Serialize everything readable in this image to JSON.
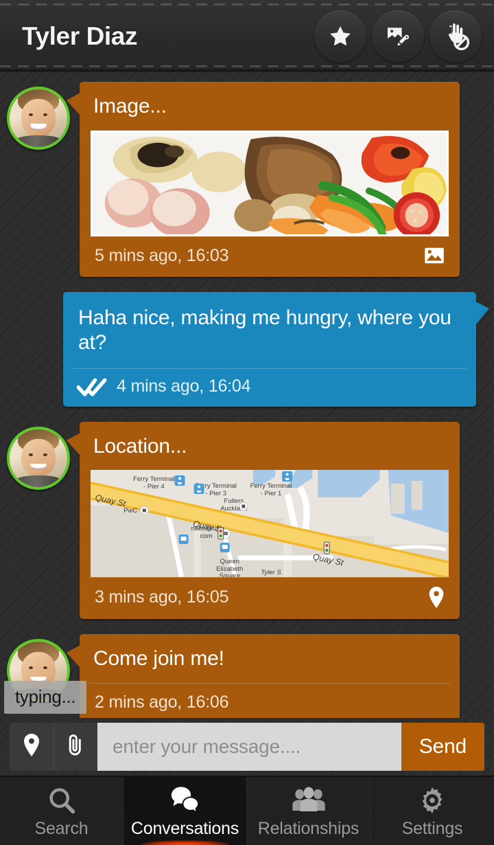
{
  "header": {
    "title": "Tyler Diaz",
    "actions": [
      {
        "name": "favorite-button",
        "icon": "star-icon"
      },
      {
        "name": "edit-photo-button",
        "icon": "image-pencil-icon"
      },
      {
        "name": "block-user-button",
        "icon": "hand-block-icon"
      }
    ]
  },
  "conversation": {
    "messages": [
      {
        "id": "m1",
        "side": "them",
        "sender": "Tyler Diaz",
        "type": "image",
        "text": "Image...",
        "time": "5 mins ago, 16:03",
        "icon": "picture-icon",
        "online": true
      },
      {
        "id": "m2",
        "side": "me",
        "type": "text",
        "text": "Haha nice, making me hungry, where you at?",
        "time": "4 mins ago, 16:04",
        "status_icon": "double-check-icon",
        "status": "read"
      },
      {
        "id": "m3",
        "side": "them",
        "sender": "Tyler Diaz",
        "type": "location",
        "text": "Location...",
        "time": "3 mins ago, 16:05",
        "icon": "map-pin-icon",
        "online": true,
        "map": {
          "labels": [
            "Quay St",
            "Ferry Terminal - Pier 4",
            "Ferry Terminal - Pier 3",
            "Ferry Terminal - Pier 1",
            "Fullers Auckland",
            "PwC",
            "nakedbus. com",
            "Quay St",
            "Quay St",
            "Queen Elizabeth Square",
            "Tyler S"
          ]
        }
      },
      {
        "id": "m4",
        "side": "them",
        "sender": "Tyler Diaz",
        "type": "text",
        "text": "Come join me!",
        "time": "2 mins ago, 16:06",
        "online": true
      }
    ],
    "typing_indicator": "typing..."
  },
  "composer": {
    "location_button": "location-pin-icon",
    "attach_button": "paperclip-icon",
    "placeholder": "enter your message....",
    "value": "",
    "send_label": "Send"
  },
  "bottom_nav": {
    "items": [
      {
        "label": "Search",
        "icon": "search-icon",
        "active": false
      },
      {
        "label": "Conversations",
        "icon": "chat-bubbles-icon",
        "active": true
      },
      {
        "label": "Relationships",
        "icon": "people-group-icon",
        "active": false
      },
      {
        "label": "Settings",
        "icon": "gear-icon",
        "active": false
      }
    ]
  },
  "colors": {
    "bubble_them": "#a85a0c",
    "bubble_me": "#1a87bd",
    "send_button": "#b35c07",
    "online_ring": "#5ec928",
    "active_tab_glow": "#ff4a0a",
    "background": "#2e2e2e"
  }
}
